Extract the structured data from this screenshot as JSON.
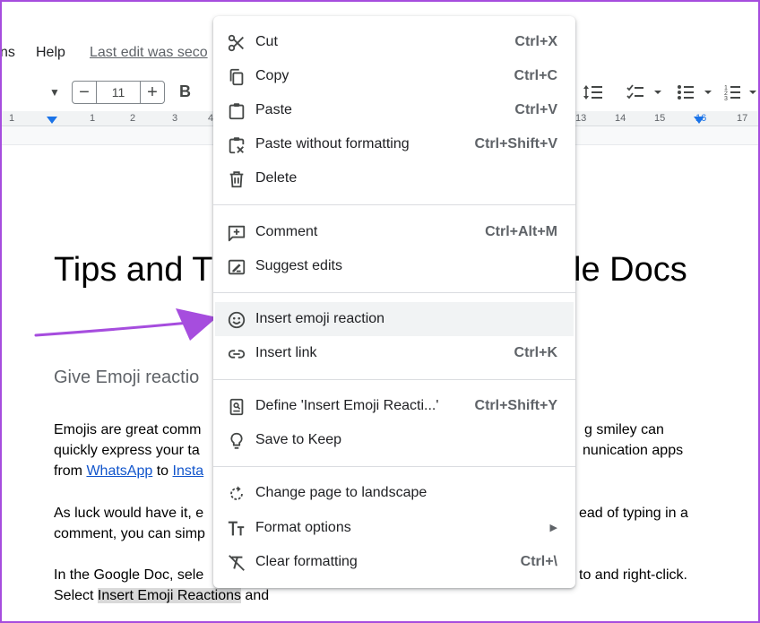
{
  "menubar": {
    "items": [
      "ns",
      "Help"
    ],
    "last_edit": "Last edit was seco"
  },
  "toolbar": {
    "minus": "−",
    "font_size": "11",
    "plus": "+",
    "bold": "B"
  },
  "ruler": {
    "ticks": [
      "1",
      "1",
      "2",
      "3",
      "4",
      "13",
      "14",
      "15",
      "16",
      "17"
    ]
  },
  "document": {
    "title_start": "Tips and T",
    "title_end": "le Docs",
    "heading": "Give Emoji reactio",
    "para1": {
      "line1_start": "Emojis are great comm",
      "line1_end": "g smiley can",
      "line2_start": "quickly express your ta",
      "line2_end": "nunication apps",
      "line3_a": "from ",
      "line3_link1": "WhatsApp",
      "line3_b": " to ",
      "line3_link2": "Insta"
    },
    "para2": {
      "line1_start": "As luck would have it, e",
      "line1_end": "ead of typing in a",
      "line2_start": "comment, you can simp"
    },
    "para3": {
      "line1_start": "In the Google Doc, sele",
      "line1_end": "to and right-click.",
      "line2_a": "Select ",
      "line2_highlight": "Insert Emoji Reactions",
      "line2_b": " and"
    }
  },
  "context_menu": {
    "highlight_color": "#f1f3f4",
    "items": [
      {
        "label": "Cut",
        "shortcut": "Ctrl+X",
        "icon": "scissors-icon"
      },
      {
        "label": "Copy",
        "shortcut": "Ctrl+C",
        "icon": "copy-icon"
      },
      {
        "label": "Paste",
        "shortcut": "Ctrl+V",
        "icon": "clipboard-icon"
      },
      {
        "label": "Paste without formatting",
        "shortcut": "Ctrl+Shift+V",
        "icon": "clipboard-clear-icon"
      },
      {
        "label": "Delete",
        "shortcut": "",
        "icon": "trash-icon"
      },
      {
        "label": "Comment",
        "shortcut": "Ctrl+Alt+M",
        "icon": "add-comment-icon"
      },
      {
        "label": "Suggest edits",
        "shortcut": "",
        "icon": "suggest-edit-icon"
      },
      {
        "label": "Insert emoji reaction",
        "shortcut": "",
        "icon": "smiley-icon"
      },
      {
        "label": "Insert link",
        "shortcut": "Ctrl+K",
        "icon": "link-icon"
      },
      {
        "label": "Define 'Insert Emoji Reacti...'",
        "shortcut": "Ctrl+Shift+Y",
        "icon": "dictionary-icon"
      },
      {
        "label": "Save to Keep",
        "shortcut": "",
        "icon": "lightbulb-icon"
      },
      {
        "label": "Change page to landscape",
        "shortcut": "",
        "icon": "rotate-icon"
      },
      {
        "label": "Format options",
        "shortcut": "",
        "icon": "text-format-icon",
        "submenu": "▶"
      },
      {
        "label": "Clear formatting",
        "shortcut": "Ctrl+\\",
        "icon": "clear-format-icon"
      }
    ]
  },
  "annotation": {
    "arrow_color": "#a64dde"
  }
}
